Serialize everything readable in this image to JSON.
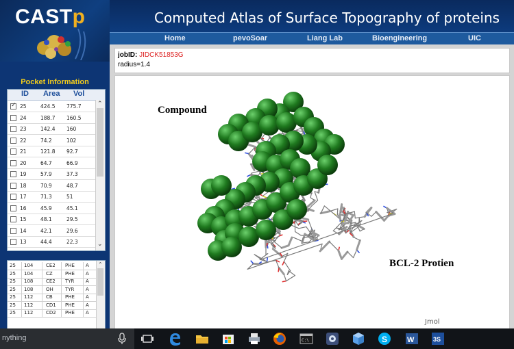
{
  "header": {
    "logo_text": "CAST",
    "logo_p": "p",
    "title": "Computed Atlas of Surface Topography of proteins",
    "nav": [
      "Home",
      "pevoSoar",
      "Liang Lab",
      "Bioengineering",
      "UIC"
    ]
  },
  "sidebar": {
    "title": "Pocket Information",
    "columns": [
      "ID",
      "Area",
      "Vol"
    ],
    "pockets": [
      {
        "id": "25",
        "area": "424.5",
        "vol": "775.7",
        "checked": true
      },
      {
        "id": "24",
        "area": "188.7",
        "vol": "160.5",
        "checked": false
      },
      {
        "id": "23",
        "area": "142.4",
        "vol": "160",
        "checked": false
      },
      {
        "id": "22",
        "area": "74.2",
        "vol": "102",
        "checked": false
      },
      {
        "id": "21",
        "area": "121.8",
        "vol": "92.7",
        "checked": false
      },
      {
        "id": "20",
        "area": "64.7",
        "vol": "66.9",
        "checked": false
      },
      {
        "id": "19",
        "area": "57.9",
        "vol": "37.3",
        "checked": false
      },
      {
        "id": "18",
        "area": "70.9",
        "vol": "48.7",
        "checked": false
      },
      {
        "id": "17",
        "area": "71.3",
        "vol": "51",
        "checked": false
      },
      {
        "id": "16",
        "area": "45.9",
        "vol": "45.1",
        "checked": false
      },
      {
        "id": "15",
        "area": "48.1",
        "vol": "29.5",
        "checked": false
      },
      {
        "id": "14",
        "area": "42.1",
        "vol": "29.6",
        "checked": false
      },
      {
        "id": "13",
        "area": "44.4",
        "vol": "22.3",
        "checked": false
      }
    ],
    "atoms": [
      [
        "25",
        "104",
        "CE2",
        "PHE",
        "A"
      ],
      [
        "25",
        "104",
        "CZ",
        "PHE",
        "A"
      ],
      [
        "25",
        "108",
        "CE2",
        "TYR",
        "A"
      ],
      [
        "25",
        "108",
        "OH",
        "TYR",
        "A"
      ],
      [
        "25",
        "112",
        "CB",
        "PHE",
        "A"
      ],
      [
        "25",
        "112",
        "CD1",
        "PHE",
        "A"
      ],
      [
        "25",
        "112",
        "CD2",
        "PHE",
        "A"
      ]
    ]
  },
  "main": {
    "job_label": "jobID:",
    "job_id": "JIDCK51853G",
    "radius": "radius=1.4",
    "label_compound": "Compound",
    "label_protein": "BCL-2 Protien",
    "viewer_tag": "Jmol"
  },
  "taskbar": {
    "search_text": "nything",
    "icons": [
      "microphone-icon",
      "task-view-icon",
      "edge-icon",
      "file-explorer-icon",
      "store-icon",
      "printer-icon",
      "firefox-icon",
      "terminal-icon",
      "settings-app-icon",
      "cube-app-icon",
      "skype-icon",
      "word-icon",
      "solidworks-icon"
    ]
  },
  "colors": {
    "header_bg": "#08306b",
    "nav_bg": "#1e5a9e",
    "sidebar_bg": "#0d3574",
    "accent_yellow": "#f2cc1c",
    "sphere_green": "#1f7a1f",
    "job_id_red": "#dd2222",
    "taskbar_bg": "#111418"
  }
}
